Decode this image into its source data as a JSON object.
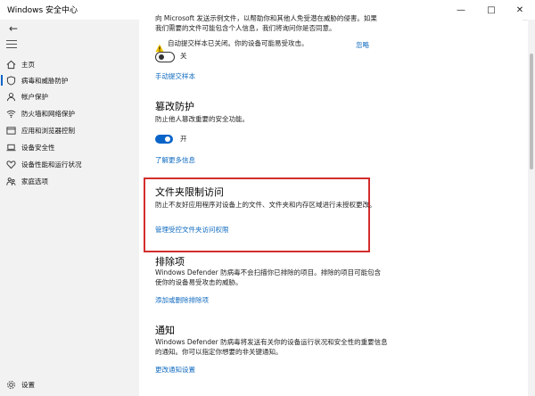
{
  "window": {
    "title": "Windows 安全中心",
    "minimize": "—",
    "maximize": "□",
    "close": "✕"
  },
  "sidebar": {
    "back": "←",
    "items": [
      {
        "label": "主页",
        "icon": "home-icon"
      },
      {
        "label": "病毒和威胁防护",
        "icon": "shield-icon",
        "active": true
      },
      {
        "label": "帐户保护",
        "icon": "person-icon"
      },
      {
        "label": "防火墙和网络保护",
        "icon": "wifi-icon"
      },
      {
        "label": "应用和浏览器控制",
        "icon": "app-window-icon"
      },
      {
        "label": "设备安全性",
        "icon": "laptop-icon"
      },
      {
        "label": "设备性能和运行状况",
        "icon": "heart-icon"
      },
      {
        "label": "家庭选项",
        "icon": "family-icon"
      }
    ],
    "settings": {
      "label": "设置",
      "icon": "gear-icon"
    }
  },
  "content": {
    "intro_line1": "向 Microsoft 发送示例文件，以帮助你和其他人免受潜在威胁的侵害。如果",
    "intro_line2": "我们需要的文件可能包含个人信息，我们将询问你是否同意。",
    "warning": "自动提交样本已关闭。你的设备可能易受攻击。",
    "dismiss": "忽略",
    "sample_toggle": "关",
    "manual_submit": "手动提交样本",
    "tamper": {
      "title": "篡改防护",
      "desc": "防止他人篡改重要的安全功能。",
      "toggle": "开",
      "link": "了解更多信息"
    },
    "folder_access": {
      "title": "文件夹限制访问",
      "desc": "防止不友好应用程序对设备上的文件、文件夹和内存区域进行未授权更改。",
      "link": "管理受控文件夹访问权限"
    },
    "exclusions": {
      "title": "排除项",
      "desc_line1": "Windows Defender 防病毒不会扫描你已排除的项目。排除的项目可能包含",
      "desc_line2": "使你的设备易受攻击的威胁。",
      "link": "添加或删除排除项"
    },
    "notifications": {
      "title": "通知",
      "desc_line1": "Windows Defender 防病毒将发送有关你的设备运行状况和安全性的重要信息",
      "desc_line2": "的通知。你可以指定你想要的非关键通知。",
      "link": "更改通知设置"
    }
  },
  "colors": {
    "accent": "#0a64c8",
    "link": "#0f6abf",
    "warning": "#f2c200",
    "highlight_box": "#d42d2d"
  }
}
